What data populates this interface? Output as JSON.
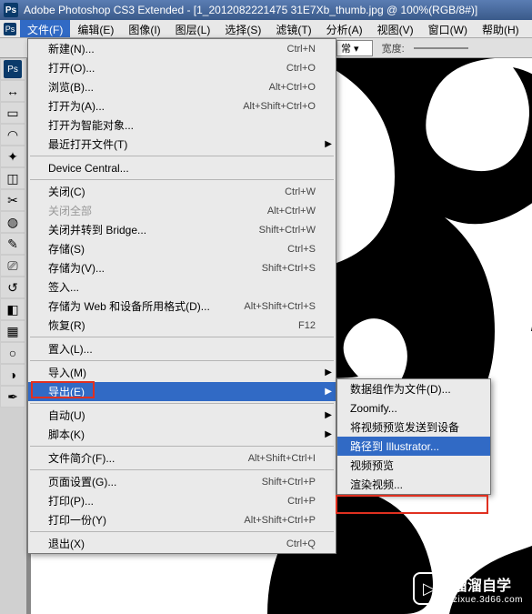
{
  "app": {
    "title": "Adobe Photoshop CS3 Extended - [1_2012082221475 31E7Xb_thumb.jpg @ 100%(RGB/8#)]",
    "ps_icon": "Ps"
  },
  "menubar": {
    "ps": "Ps",
    "items": [
      {
        "label": "文件(F)",
        "active": true
      },
      {
        "label": "编辑(E)"
      },
      {
        "label": "图像(I)"
      },
      {
        "label": "图层(L)"
      },
      {
        "label": "选择(S)"
      },
      {
        "label": "滤镜(T)"
      },
      {
        "label": "分析(A)"
      },
      {
        "label": "视图(V)"
      },
      {
        "label": "窗口(W)"
      },
      {
        "label": "帮助(H)"
      }
    ]
  },
  "optionsbar": {
    "dropdown_value": "常",
    "label_width": "宽度:",
    "width_value": ""
  },
  "file_menu": [
    {
      "label": "新建(N)...",
      "shortcut": "Ctrl+N"
    },
    {
      "label": "打开(O)...",
      "shortcut": "Ctrl+O"
    },
    {
      "label": "浏览(B)...",
      "shortcut": "Alt+Ctrl+O"
    },
    {
      "label": "打开为(A)...",
      "shortcut": "Alt+Shift+Ctrl+O"
    },
    {
      "label": "打开为智能对象..."
    },
    {
      "label": "最近打开文件(T)",
      "submenu": true
    },
    {
      "sep": true
    },
    {
      "label": "Device Central..."
    },
    {
      "sep": true
    },
    {
      "label": "关闭(C)",
      "shortcut": "Ctrl+W"
    },
    {
      "label": "关闭全部",
      "shortcut": "Alt+Ctrl+W",
      "disabled": true
    },
    {
      "label": "关闭并转到 Bridge...",
      "shortcut": "Shift+Ctrl+W"
    },
    {
      "label": "存储(S)",
      "shortcut": "Ctrl+S"
    },
    {
      "label": "存储为(V)...",
      "shortcut": "Shift+Ctrl+S"
    },
    {
      "label": "签入..."
    },
    {
      "label": "存储为 Web 和设备所用格式(D)...",
      "shortcut": "Alt+Shift+Ctrl+S"
    },
    {
      "label": "恢复(R)",
      "shortcut": "F12"
    },
    {
      "sep": true
    },
    {
      "label": "置入(L)..."
    },
    {
      "sep": true
    },
    {
      "label": "导入(M)",
      "submenu": true
    },
    {
      "label": "导出(E)",
      "submenu": true,
      "highlight": true,
      "redbox": true
    },
    {
      "sep": true
    },
    {
      "label": "自动(U)",
      "submenu": true
    },
    {
      "label": "脚本(K)",
      "submenu": true
    },
    {
      "sep": true
    },
    {
      "label": "文件简介(F)...",
      "shortcut": "Alt+Shift+Ctrl+I"
    },
    {
      "sep": true
    },
    {
      "label": "页面设置(G)...",
      "shortcut": "Shift+Ctrl+P"
    },
    {
      "label": "打印(P)...",
      "shortcut": "Ctrl+P"
    },
    {
      "label": "打印一份(Y)",
      "shortcut": "Alt+Shift+Ctrl+P"
    },
    {
      "sep": true
    },
    {
      "label": "退出(X)",
      "shortcut": "Ctrl+Q"
    }
  ],
  "export_submenu": [
    {
      "label": "数据组作为文件(D)...",
      "disabled": true
    },
    {
      "label": "Zoomify..."
    },
    {
      "label": "将视频预览发送到设备"
    },
    {
      "label": "路径到 Illustrator...",
      "highlight": true,
      "redbox": true
    },
    {
      "label": "视频预览"
    },
    {
      "label": "渲染视频..."
    }
  ],
  "tool_icons": [
    {
      "name": "ps-logo",
      "txt": "Ps"
    },
    {
      "name": "move-tool",
      "txt": "↔"
    },
    {
      "name": "marquee-tool",
      "txt": "▭"
    },
    {
      "name": "lasso-tool",
      "txt": "◠"
    },
    {
      "name": "wand-tool",
      "txt": "✦"
    },
    {
      "name": "crop-tool",
      "txt": "◫"
    },
    {
      "name": "slice-tool",
      "txt": "✂"
    },
    {
      "name": "heal-tool",
      "txt": "◍"
    },
    {
      "name": "brush-tool",
      "txt": "✎"
    },
    {
      "name": "stamp-tool",
      "txt": "⎚"
    },
    {
      "name": "history-tool",
      "txt": "↺"
    },
    {
      "name": "eraser-tool",
      "txt": "◧"
    },
    {
      "name": "gradient-tool",
      "txt": "▦"
    },
    {
      "name": "blur-tool",
      "txt": "○"
    },
    {
      "name": "dodge-tool",
      "txt": "◑"
    },
    {
      "name": "pen-tool",
      "txt": "✒"
    }
  ],
  "watermark": {
    "brand": "溜溜自学",
    "url": "zixue.3d66.com",
    "play": "▷"
  }
}
